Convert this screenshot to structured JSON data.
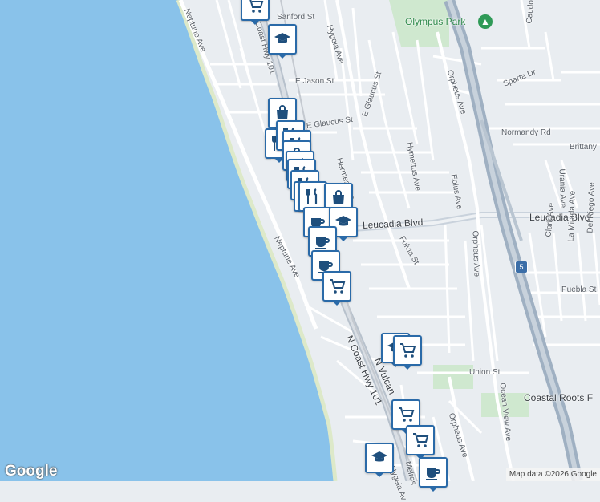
{
  "map": {
    "colors": {
      "water": "#89c2ea",
      "land": "#e9edf1",
      "road": "#ffffff",
      "highway": "#a9b6c4",
      "park": "#cfe8cf",
      "marker_border": "#2a6aa8"
    },
    "park": {
      "name": "Olympus Park",
      "icon": "tree-icon"
    },
    "streets": {
      "neptune_top": "Neptune Ave",
      "sanford": "Sanford St",
      "hwy101_top": "N Coast Hwy 101",
      "hygeia": "Hygeia Ave",
      "jason": "E Jason St",
      "glaucus_st": "E Glaucus St",
      "glaucus_st2": "E Glaucus St",
      "hermes": "Hermes Ave",
      "leucadia_blvd": "Leucadia Blvd",
      "leucadia_blvd_right": "Leucadia Blvd",
      "hymettus": "Hymettus Ave",
      "eolus": "Eolus Ave",
      "orpheus_top": "Orpheus Ave",
      "orpheus_mid": "Orpheus Ave",
      "orpheus_bottom": "Orpheus Ave",
      "sparta": "Sparta Dr",
      "caudor": "Caudor St",
      "normandy": "Normandy Rd",
      "brittany": "Brittany",
      "urania": "Urania Ave",
      "clark": "Clark Ave",
      "la_mirada": "La Mirada Ave",
      "del_riego": "Del Riego Ave",
      "puebla": "Puebla St",
      "fulvia": "Fulvia St",
      "neptune_mid": "Neptune Ave",
      "hwy101_bottom": "N Coast Hwy 101",
      "vulcan": "N Vulcan",
      "union": "Union St",
      "ocean_view": "Ocean View Ave",
      "coastal_roots": "Coastal Roots F",
      "melrose": "Melros",
      "hygeia_bottom": "Hygeia Av"
    },
    "highway_shield": "5",
    "markers": [
      {
        "type": "cart",
        "icon": "shopping-cart-icon"
      },
      {
        "type": "school",
        "icon": "graduation-cap-icon"
      },
      {
        "type": "shopping",
        "icon": "shopping-bag-icon"
      },
      {
        "type": "restaurant",
        "icon": "fork-knife-icon"
      },
      {
        "type": "restaurant",
        "icon": "fork-knife-icon"
      },
      {
        "type": "restaurant",
        "icon": "fork-knife-icon"
      },
      {
        "type": "shopping",
        "icon": "shopping-bag-icon"
      },
      {
        "type": "restaurant",
        "icon": "fork-knife-icon"
      },
      {
        "type": "restaurant",
        "icon": "fork-knife-icon"
      },
      {
        "type": "restaurant",
        "icon": "fork-knife-icon"
      },
      {
        "type": "restaurant",
        "icon": "fork-knife-icon"
      },
      {
        "type": "restaurant",
        "icon": "fork-knife-icon"
      },
      {
        "type": "shopping",
        "icon": "shopping-bag-icon"
      },
      {
        "type": "cafe",
        "icon": "coffee-cup-icon"
      },
      {
        "type": "school",
        "icon": "graduation-cap-icon"
      },
      {
        "type": "cafe",
        "icon": "coffee-cup-icon"
      },
      {
        "type": "cafe",
        "icon": "coffee-cup-icon"
      },
      {
        "type": "cart",
        "icon": "shopping-cart-icon"
      },
      {
        "type": "school",
        "icon": "graduation-cap-icon"
      },
      {
        "type": "cart",
        "icon": "shopping-cart-icon"
      },
      {
        "type": "cart",
        "icon": "shopping-cart-icon"
      },
      {
        "type": "cart",
        "icon": "shopping-cart-icon"
      },
      {
        "type": "school",
        "icon": "graduation-cap-icon"
      },
      {
        "type": "cafe",
        "icon": "coffee-cup-icon"
      }
    ]
  },
  "branding": {
    "logo": "Google",
    "attribution": "Map data ©2026 Google"
  }
}
